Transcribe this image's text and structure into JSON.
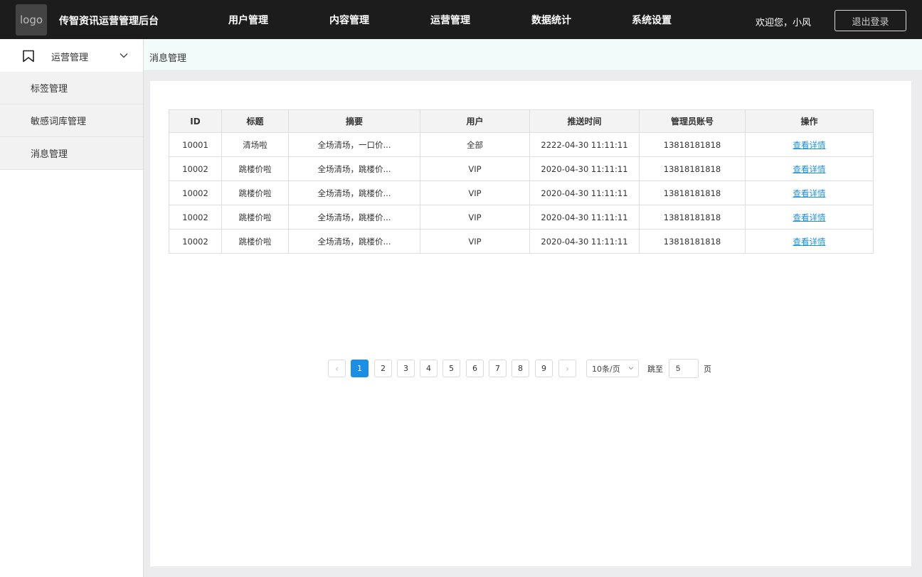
{
  "header": {
    "logo_text": "logo",
    "app_title": "传智资讯运营管理后台",
    "nav": [
      "用户管理",
      "内容管理",
      "运营管理",
      "数据统计",
      "系统设置"
    ],
    "welcome": "欢迎您，小风",
    "logout_label": "退出登录"
  },
  "sidebar": {
    "group_label": "运营管理",
    "group_icon": "bookmark-icon",
    "items": [
      "标签管理",
      "敏感词库管理",
      "消息管理"
    ]
  },
  "breadcrumb": "消息管理",
  "table": {
    "columns": [
      "ID",
      "标题",
      "摘要",
      "用户",
      "推送时间",
      "管理员账号",
      "操作"
    ],
    "rows": [
      [
        "10001",
        "清场啦",
        "全场清场，一口价...",
        "全部",
        "2222-04-30 11:11:11",
        "13818181818",
        "查看详情"
      ],
      [
        "10002",
        "跳楼价啦",
        "全场清场，跳楼价...",
        "VIP",
        "2020-04-30 11:11:11",
        "13818181818",
        "查看详情"
      ],
      [
        "10002",
        "跳楼价啦",
        "全场清场，跳楼价...",
        "VIP",
        "2020-04-30 11:11:11",
        "13818181818",
        "查看详情"
      ],
      [
        "10002",
        "跳楼价啦",
        "全场清场，跳楼价...",
        "VIP",
        "2020-04-30 11:11:11",
        "13818181818",
        "查看详情"
      ],
      [
        "10002",
        "跳楼价啦",
        "全场清场，跳楼价...",
        "VIP",
        "2020-04-30 11:11:11",
        "13818181818",
        "查看详情"
      ]
    ]
  },
  "pagination": {
    "prev": "‹",
    "next": "›",
    "pages": [
      "1",
      "2",
      "3",
      "4",
      "5",
      "6",
      "7",
      "8",
      "9"
    ],
    "current": "1",
    "page_size": "10条/页",
    "jump_label": "跳至",
    "jump_value": "5",
    "page_unit": "页"
  },
  "colors": {
    "topbar": "#1c1c1c",
    "accent": "#1a8fe3",
    "breadcrumb_bg": "#f2fafa"
  }
}
